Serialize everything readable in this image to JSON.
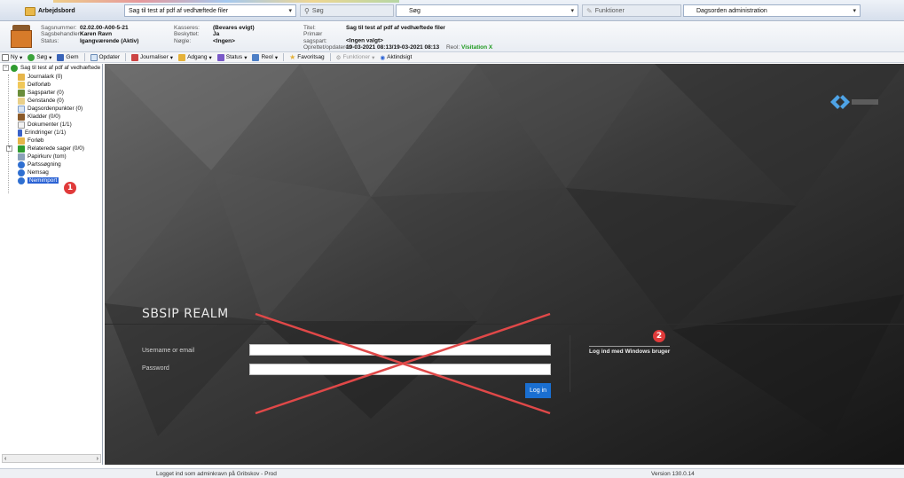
{
  "topbar": {
    "workbench_label": "Arbejdsbord",
    "case_combo_value": "Sag til test af pdf af vedhæftede filer",
    "search_button_label": "Søg",
    "search_combo_value": "Søg",
    "functions_label": "Funktioner",
    "agenda_combo_value": "Dagsorden administration"
  },
  "case_info": {
    "case_number_label": "Sagsnummer:",
    "case_number_value": "02.02.00-A00-5-21",
    "handler_label": "Sagsbehandler:",
    "handler_value": "Karen Ravn",
    "status_label": "Status:",
    "status_value": "Igangværende (Aktiv)",
    "discard_label": "Kasseres:",
    "discard_value": "(Bevares evigt)",
    "protected_label": "Beskyttet:",
    "protected_value": "Ja",
    "keywords_label": "Nøgle:",
    "keywords_value": "<Ingen>",
    "title_label": "Titel:",
    "title_value": "Sag til test af pdf af vedhæftede filer",
    "primary_party_label": "Primær sagspart:",
    "primary_party_value": "<Ingen valgt>",
    "created_label": "Oprettet/opdateret:",
    "created_value": "19-03-2021 08:13/19-03-2021 08:13",
    "shelf_label": "Reol:",
    "shelf_value": "Visitation X"
  },
  "toolbar": {
    "items": [
      "Ny",
      "Søg",
      "Gem",
      "Opdater",
      "Journaliser",
      "Adgang",
      "Status",
      "Reol",
      "Favoritsag",
      "Funktioner",
      "Aktindsigt"
    ]
  },
  "tree": {
    "root": "Sag til test af pdf af vedhæftede",
    "items": [
      "Journalark (0)",
      "Delforløb",
      "Sagsparter (0)",
      "Genstande (0)",
      "Dagsordenpunkter (0)",
      "Kladder (0/0)",
      "Dokumenter (1/1)",
      "Erindringer (1/1)",
      "Forløb",
      "Relaterede sager (0/0)",
      "Papirkurv (tom)",
      "Partssøgning",
      "Nemsag",
      "Nemimport"
    ]
  },
  "login": {
    "realm_title": "SBSIP REALM",
    "username_label": "Username or email",
    "password_label": "Password",
    "login_button": "Log in",
    "windows_link": "Log ind med Windows bruger"
  },
  "annotations": {
    "badge_1": "1",
    "badge_2": "2",
    "cross_color": "#e04848"
  },
  "statusbar": {
    "logged_in_text": "Logget ind som adminkravn på Gribskov - Prod",
    "version_text": "Version 130.0.14"
  },
  "icons": [
    "folder-icon",
    "search-icon",
    "functions-icon",
    "case-icon",
    "tree-node-icon",
    "dropdown-arrow-icon",
    "logo-icon"
  ]
}
